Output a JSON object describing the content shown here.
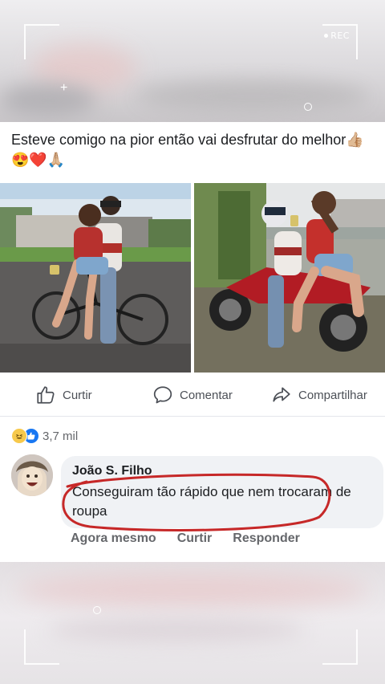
{
  "overlay": {
    "rec_label": "REC"
  },
  "post": {
    "text": "Esteve comigo na pior então vai desfrutar do melhor👍🏼😍❤️🙏🏼"
  },
  "actions": {
    "like_label": "Curtir",
    "comment_label": "Comentar",
    "share_label": "Compartilhar"
  },
  "reactions": {
    "icons": [
      "haha-icon",
      "like-icon"
    ],
    "count": "3,7 mil"
  },
  "comment": {
    "author": "João S. Filho",
    "text": "Conseguiram tão rápido que nem trocaram de roupa",
    "time": "Agora mesmo",
    "like_label": "Curtir",
    "reply_label": "Responder",
    "highlight_color": "#c62828"
  },
  "colors": {
    "text": "#1c1e21",
    "secondary": "#65676b",
    "bubble": "#f0f2f5",
    "like_blue": "#1877f2"
  }
}
